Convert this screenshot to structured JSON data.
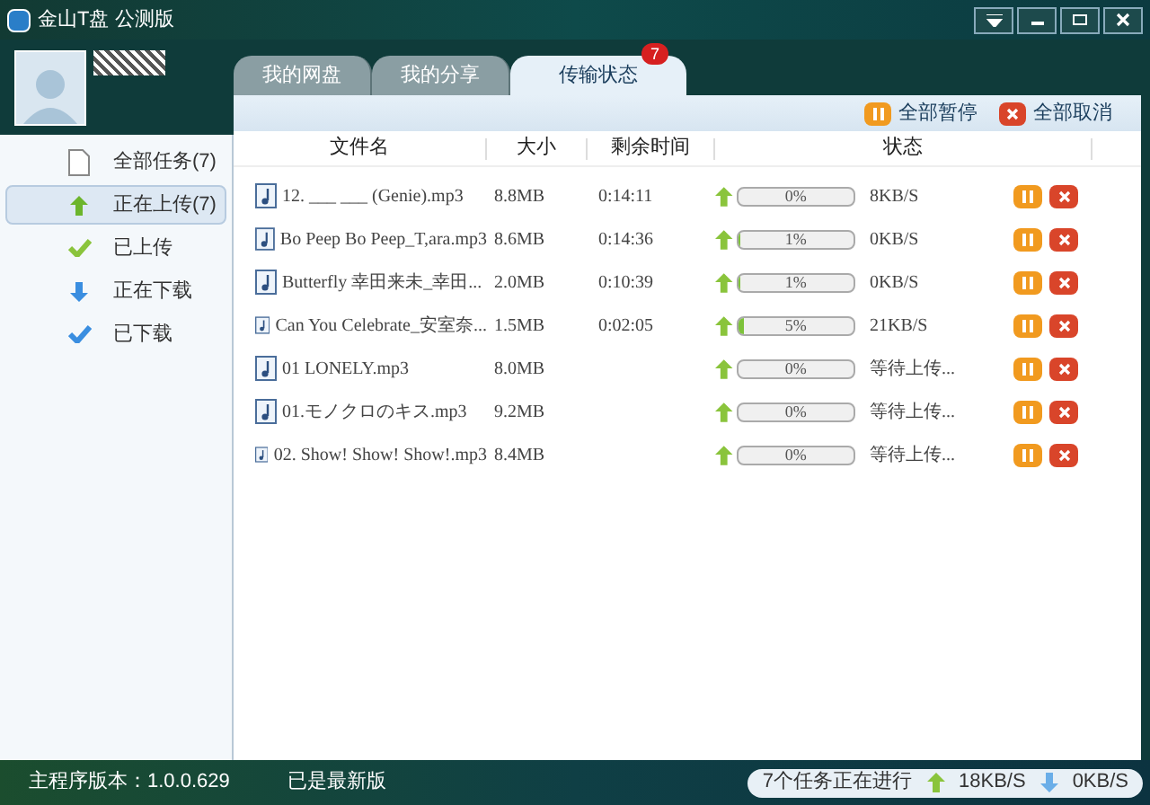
{
  "window": {
    "title": "金山T盘 公测版"
  },
  "tabs": [
    {
      "label": "我的网盘",
      "selected": false
    },
    {
      "label": "我的分享",
      "selected": false
    },
    {
      "label": "传输状态",
      "selected": true,
      "badge": "7"
    }
  ],
  "toolbar": {
    "pause_all": "全部暂停",
    "cancel_all": "全部取消"
  },
  "sidebar": {
    "items": [
      {
        "label": "全部任务(7)",
        "kind": "all",
        "selected": false
      },
      {
        "label": "正在上传(7)",
        "kind": "uploading",
        "selected": true
      },
      {
        "label": "已上传",
        "kind": "uploaded",
        "selected": false
      },
      {
        "label": "正在下载",
        "kind": "downloading",
        "selected": false
      },
      {
        "label": "已下载",
        "kind": "downloaded",
        "selected": false
      }
    ]
  },
  "table": {
    "columns": [
      "文件名",
      "大小",
      "剩余时间",
      "状态"
    ],
    "rows": [
      {
        "name": "12. ___ ___ (Genie).mp3",
        "size": "8.8MB",
        "remaining": "0:14:11",
        "level": 0,
        "percent": "0%",
        "status": "8KB/S"
      },
      {
        "name": "Bo Peep Bo Peep_T,ara.mp3",
        "size": "8.6MB",
        "remaining": "0:14:36",
        "level": 0.01,
        "percent": "1%",
        "status": "0KB/S"
      },
      {
        "name": "Butterfly 幸田来未_幸田...",
        "size": "2.0MB",
        "remaining": "0:10:39",
        "level": 0.01,
        "percent": "1%",
        "status": "0KB/S"
      },
      {
        "name": "Can You Celebrate_安室奈...",
        "size": "1.5MB",
        "remaining": "0:02:05",
        "level": 0.05,
        "percent": "5%",
        "status": "21KB/S"
      },
      {
        "name": "01 LONELY.mp3",
        "size": "8.0MB",
        "level": 0,
        "percent": "0%",
        "status": "等待上传..."
      },
      {
        "name": "01.モノクロのキス.mp3",
        "size": "9.2MB",
        "level": 0,
        "percent": "0%",
        "status": "等待上传..."
      },
      {
        "name": "02. Show! Show! Show!.mp3",
        "size": "8.4MB",
        "level": 0,
        "percent": "0%",
        "status": "等待上传..."
      }
    ]
  },
  "status_bar": {
    "version": "主程序版本：1.0.0.629",
    "update": "已是最新版",
    "tasks": "7个任务正在进行",
    "upload_speed": "18KB/S",
    "download_speed": "0KB/S"
  }
}
